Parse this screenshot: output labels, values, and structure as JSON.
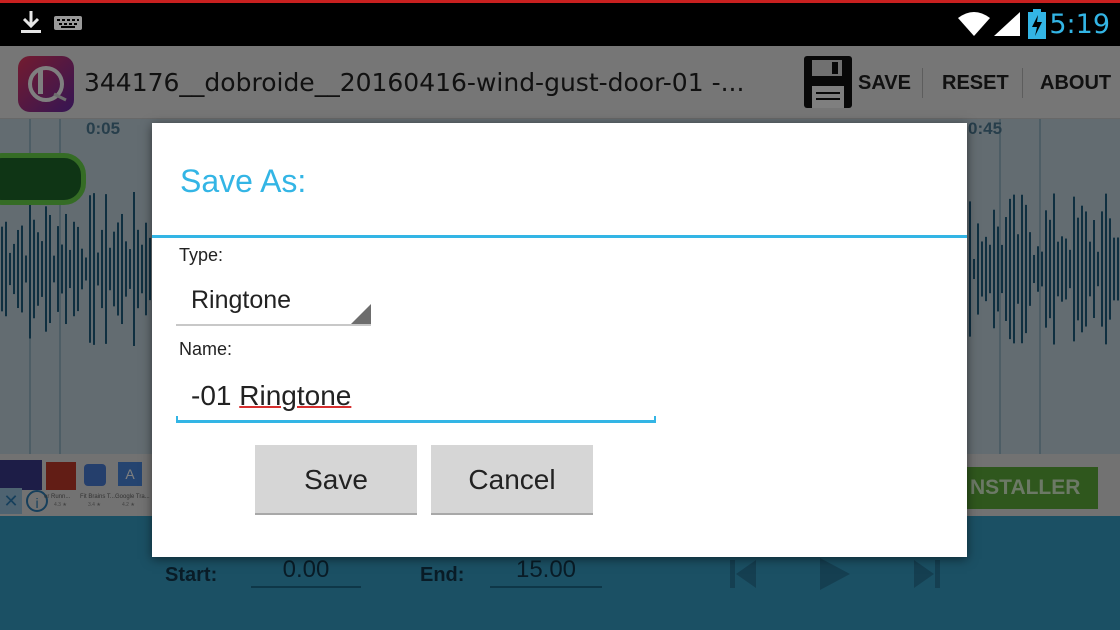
{
  "status_bar": {
    "time": "5:19",
    "icons": [
      "download-icon",
      "keyboard-icon",
      "wifi-icon",
      "signal-icon",
      "battery-charging-icon"
    ]
  },
  "action_bar": {
    "app_icon": "ringtone-maker-logo",
    "title": "344176__dobroide__20160416-wind-gust-door-01 -...",
    "save_label": "SAVE",
    "reset_label": "RESET",
    "about_label": "ABOUT",
    "save_icon": "floppy-disk-icon"
  },
  "waveform": {
    "time_labels": [
      "0:05",
      "0:45"
    ]
  },
  "ad_banner": {
    "button_label": "NSTALLER",
    "apps": [
      {
        "name": "er Runn...",
        "rating": "4.3 ★"
      },
      {
        "name": "Fit Brains T...",
        "rating": "3.4 ★"
      },
      {
        "name": "Google Tra...",
        "rating": "4.2 ★"
      }
    ]
  },
  "controls": {
    "start_label": "Start:",
    "start_value": "0.00",
    "end_label": "End:",
    "end_value": "15.00"
  },
  "dialog": {
    "title": "Save As:",
    "type_label": "Type:",
    "type_value": "Ringtone",
    "name_label": "Name:",
    "name_prefix": "-01 ",
    "name_word": "Ringtone",
    "save_button": "Save",
    "cancel_button": "Cancel"
  },
  "colors": {
    "accent": "#33b5e5",
    "controls_bg": "#36a0c8",
    "installer_green": "#5fae3a"
  }
}
